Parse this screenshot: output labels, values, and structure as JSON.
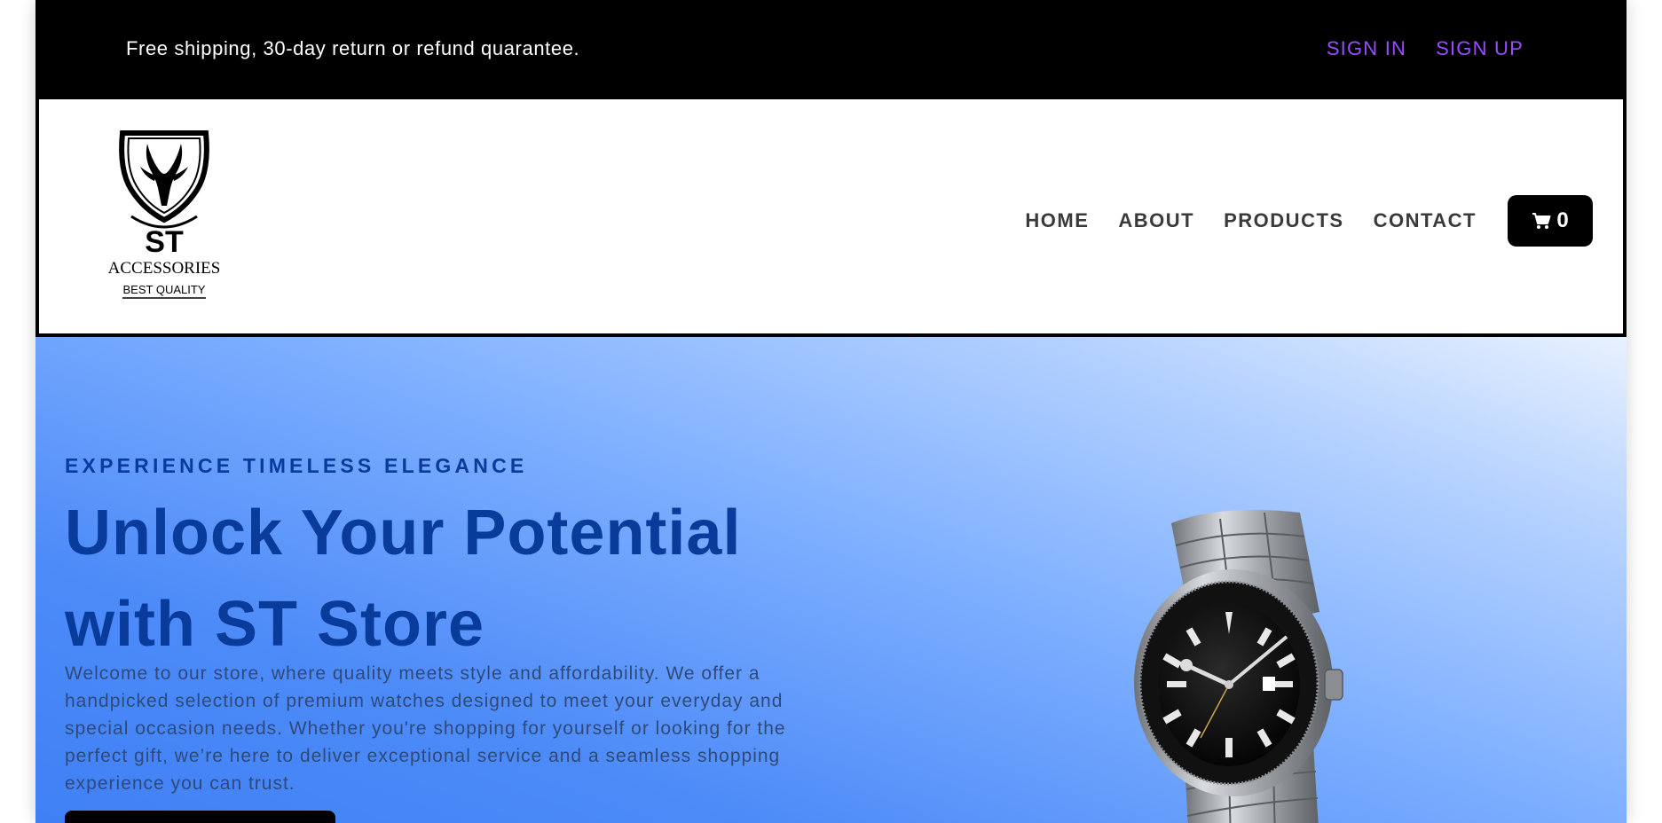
{
  "topbar": {
    "promo": "Free shipping, 30-day return or refund quarantee.",
    "sign_in": "SIGN IN",
    "sign_up": "SIGN UP"
  },
  "brand": {
    "name": "ST",
    "line1": "ACCESSORIES",
    "line2": "BEST QUALITY"
  },
  "nav": {
    "items": [
      "HOME",
      "ABOUT",
      "PRODUCTS",
      "CONTACT"
    ],
    "cart_count": "0",
    "cart_icon": "shopping-cart-icon"
  },
  "hero": {
    "eyebrow": "EXPERIENCE TIMELESS ELEGANCE",
    "headline_line1": "Unlock Your Potential",
    "headline_line2": "with ST Store",
    "description": "Welcome to our store, where quality meets style and affordability. We offer a handpicked selection of premium watches designed to meet your everyday and special occasion needs. Whether you're shopping for yourself or looking for the perfect gift, we’re here to deliver exceptional service and a seamless shopping experience you can trust."
  },
  "colors": {
    "topbar_bg": "#000000",
    "auth_link": "#9a4dff",
    "hero_text": "#093c9a",
    "hero_gradient_start": "#e8f1ff",
    "hero_gradient_end": "#3f80f5"
  }
}
